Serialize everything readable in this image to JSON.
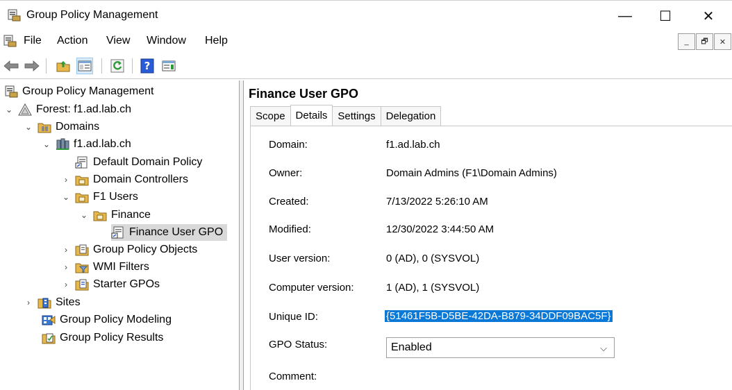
{
  "window": {
    "title": "Group Policy Management",
    "minimize": "—",
    "maximize": "☐",
    "close": "✕"
  },
  "menu": {
    "items": [
      "File",
      "Action",
      "View",
      "Window",
      "Help"
    ],
    "mdi": [
      "_",
      "🗗",
      "✕"
    ]
  },
  "tree": {
    "items": [
      {
        "label": "Group Policy Management"
      },
      {
        "label": "Forest: f1.ad.lab.ch",
        "chev": "⌄"
      },
      {
        "label": "Domains",
        "chev": "⌄"
      },
      {
        "label": "f1.ad.lab.ch",
        "chev": "⌄"
      },
      {
        "label": "Default Domain Policy"
      },
      {
        "label": "Domain Controllers",
        "chev": "›"
      },
      {
        "label": "F1 Users",
        "chev": "⌄"
      },
      {
        "label": "Finance",
        "chev": "⌄"
      },
      {
        "label": "Finance User GPO"
      },
      {
        "label": "Group Policy Objects",
        "chev": "›"
      },
      {
        "label": "WMI Filters",
        "chev": "›"
      },
      {
        "label": "Starter GPOs",
        "chev": "›"
      },
      {
        "label": "Sites",
        "chev": "›"
      },
      {
        "label": "Group Policy Modeling"
      },
      {
        "label": "Group Policy Results"
      }
    ]
  },
  "details": {
    "title": "Finance User GPO",
    "tabs": [
      "Scope",
      "Details",
      "Settings",
      "Delegation"
    ],
    "active_tab": "Details",
    "fields": [
      {
        "label": "Domain:",
        "value": "f1.ad.lab.ch"
      },
      {
        "label": "Owner:",
        "value": "Domain Admins (F1\\Domain Admins)"
      },
      {
        "label": "Created:",
        "value": "7/13/2022 5:26:10 AM"
      },
      {
        "label": "Modified:",
        "value": "12/30/2022 3:44:50 AM"
      },
      {
        "label": "User version:",
        "value": "0 (AD), 0 (SYSVOL)"
      },
      {
        "label": "Computer version:",
        "value": "1 (AD), 1 (SYSVOL)"
      },
      {
        "label": "Unique ID:",
        "value": "{51461F5B-D5BE-42DA-B879-34DDF09BAC5F}"
      },
      {
        "label": "GPO Status:",
        "value": "Enabled"
      },
      {
        "label": "Comment:",
        "value": ""
      }
    ],
    "status_caret": "⌵"
  },
  "colors": {
    "selection": "#0a78d7",
    "tree_selected": "#d9d9d9",
    "folder": "#e8b84a",
    "refresh": "#2e9a3a",
    "help": "#2a5bd6"
  }
}
